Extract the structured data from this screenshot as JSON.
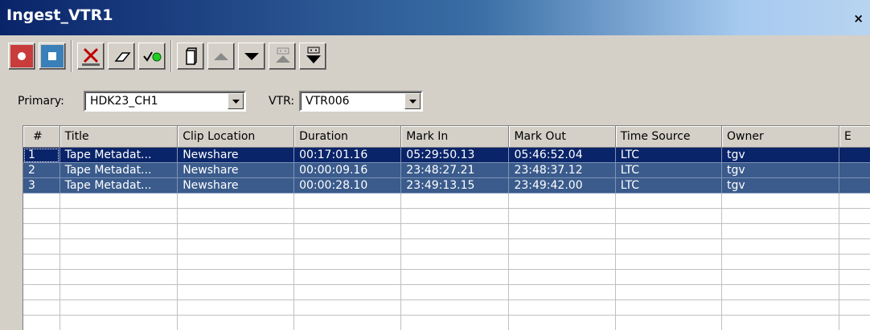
{
  "window": {
    "title": "Ingest_VTR1",
    "close_label": "×"
  },
  "toolbar": {
    "buttons": [
      {
        "name": "record-button",
        "icon": "record-icon"
      },
      {
        "name": "stop-button",
        "icon": "stop-icon"
      },
      {
        "name": "delete-button",
        "icon": "delete-x-icon"
      },
      {
        "name": "erase-button",
        "icon": "eraser-icon"
      },
      {
        "name": "check-button",
        "icon": "check-green-dot-icon"
      },
      {
        "name": "copy-button",
        "icon": "page-icon"
      },
      {
        "name": "move-up-button",
        "icon": "triangle-up-icon"
      },
      {
        "name": "move-down-button",
        "icon": "triangle-down-icon"
      },
      {
        "name": "move-top-button",
        "icon": "move-top-icon"
      },
      {
        "name": "move-bottom-button",
        "icon": "move-bottom-icon"
      }
    ]
  },
  "selectors": {
    "primary_label": "Primary:",
    "primary_value": "HDK23_CH1",
    "vtr_label": "VTR:",
    "vtr_value": "VTR006"
  },
  "table": {
    "columns": [
      "#",
      "Title",
      "Clip Location",
      "Duration",
      "Mark In",
      "Mark Out",
      "Time Source",
      "Owner",
      "E"
    ],
    "rows": [
      [
        "1",
        "Tape Metadat...",
        "Newshare",
        "00:17:01.16",
        "05:29:50.13",
        "05:46:52.04",
        "LTC",
        "tgv",
        ""
      ],
      [
        "2",
        "Tape Metadat...",
        "Newshare",
        "00:00:09.16",
        "23:48:27.21",
        "23:48:37.12",
        "LTC",
        "tgv",
        ""
      ],
      [
        "3",
        "Tape Metadat...",
        "Newshare",
        "00:00:28.10",
        "23:49:13.15",
        "23:49:42.00",
        "LTC",
        "tgv",
        ""
      ]
    ],
    "empty_rows": 9
  },
  "colors": {
    "selection_primary": "#0a246a",
    "selection_secondary": "#3a5b8c",
    "record_red": "#c83c3c",
    "stop_blue": "#3a7fb8"
  }
}
